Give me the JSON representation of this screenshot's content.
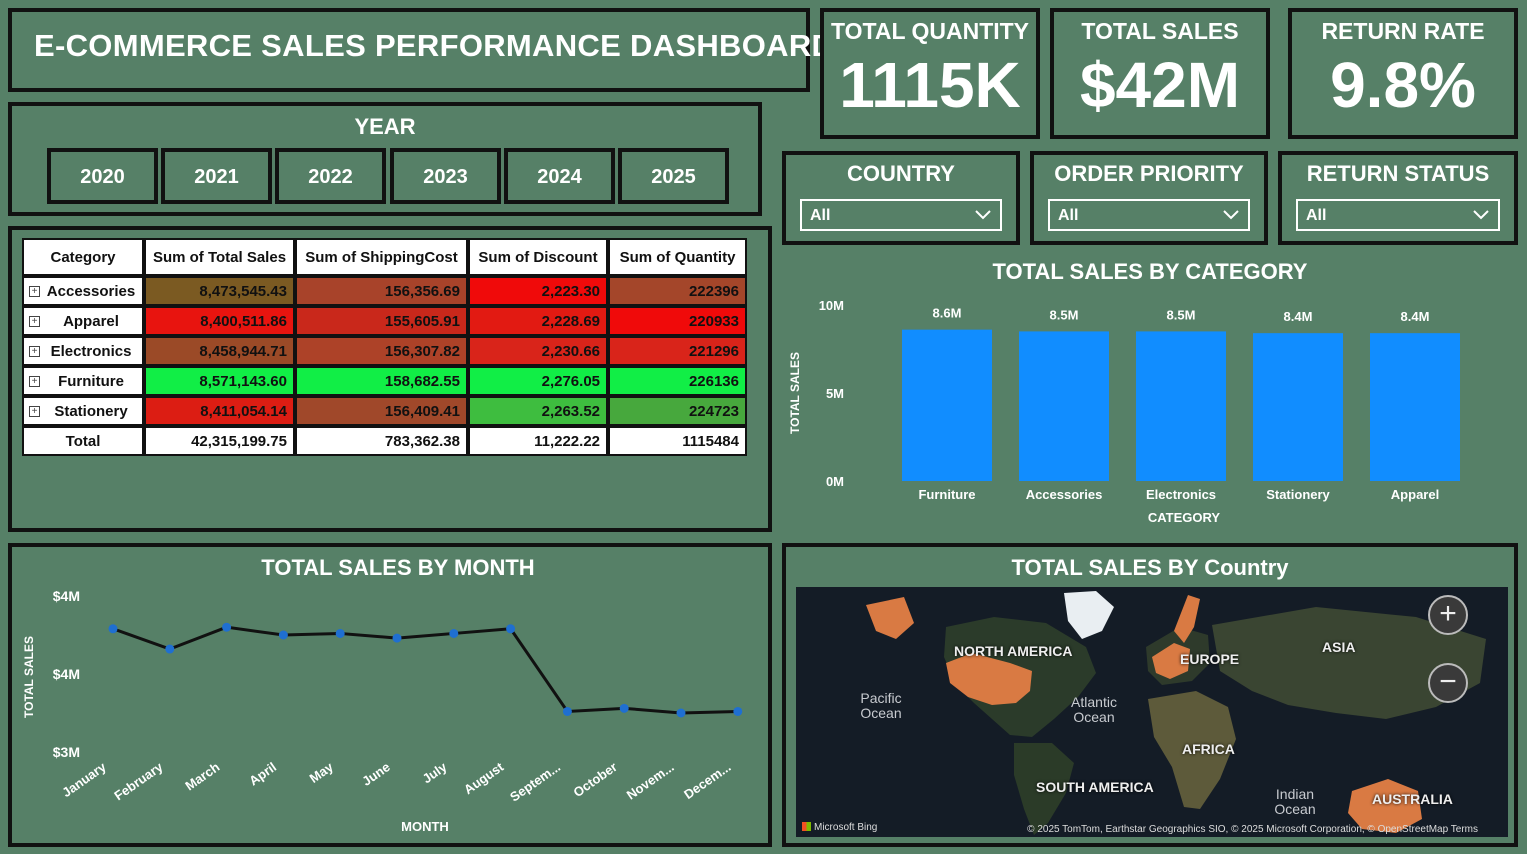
{
  "title": "E-COMMERCE SALES PERFORMANCE DASHBOARD",
  "kpis": {
    "quantity": {
      "label": "TOTAL QUANTITY",
      "value": "1115K"
    },
    "sales": {
      "label": "TOTAL SALES",
      "value": "$42M"
    },
    "return": {
      "label": "RETURN RATE",
      "value": "9.8%"
    }
  },
  "year_slicer": {
    "label": "YEAR",
    "years": [
      "2020",
      "2021",
      "2022",
      "2023",
      "2024",
      "2025"
    ]
  },
  "slicers": {
    "country": {
      "label": "COUNTRY",
      "value": "All"
    },
    "priority": {
      "label": "ORDER PRIORITY",
      "value": "All"
    },
    "return_status": {
      "label": "RETURN STATUS",
      "value": "All"
    }
  },
  "matrix": {
    "headers": [
      "Category",
      "Sum of Total Sales",
      "Sum of ShippingCost",
      "Sum of Discount",
      "Sum of Quantity"
    ],
    "rows": [
      {
        "category": "Accessories",
        "sales": "8,473,545.43",
        "shipping": "156,356.69",
        "discount": "2,223.30",
        "quantity": "222396",
        "colors": [
          "#7b5a22",
          "#a8432a",
          "#f00a0a",
          "#a4462a"
        ]
      },
      {
        "category": "Apparel",
        "sales": "8,400,511.86",
        "shipping": "155,605.91",
        "discount": "2,228.69",
        "quantity": "220933",
        "colors": [
          "#e8140f",
          "#c9281b",
          "#e21a12",
          "#f00a0a"
        ]
      },
      {
        "category": "Electronics",
        "sales": "8,458,944.71",
        "shipping": "156,307.82",
        "discount": "2,230.66",
        "quantity": "221296",
        "colors": [
          "#9b4a27",
          "#ad4228",
          "#d9241a",
          "#d9241a"
        ]
      },
      {
        "category": "Furniture",
        "sales": "8,571,143.60",
        "shipping": "158,682.55",
        "discount": "2,276.05",
        "quantity": "226136",
        "colors": [
          "#11ee46",
          "#11ee46",
          "#11ee46",
          "#11ee46"
        ]
      },
      {
        "category": "Stationery",
        "sales": "8,411,054.14",
        "shipping": "156,409.41",
        "discount": "2,263.52",
        "quantity": "224723",
        "colors": [
          "#dc1d13",
          "#a0482a",
          "#3ebd3f",
          "#47a83d"
        ]
      }
    ],
    "total": {
      "category": "Total",
      "sales": "42,315,199.75",
      "shipping": "783,362.38",
      "discount": "11,222.22",
      "quantity": "1115484"
    }
  },
  "chart_data": [
    {
      "type": "bar",
      "title": "TOTAL SALES BY CATEGORY",
      "xlabel": "CATEGORY",
      "ylabel": "TOTAL SALES",
      "categories": [
        "Furniture",
        "Accessories",
        "Electronics",
        "Stationery",
        "Apparel"
      ],
      "values": [
        8.6,
        8.5,
        8.5,
        8.4,
        8.4
      ],
      "data_labels": [
        "8.6M",
        "8.5M",
        "8.5M",
        "8.4M",
        "8.4M"
      ],
      "ylim": [
        0,
        10
      ],
      "yticks": [
        0,
        5,
        10
      ],
      "ytick_labels": [
        "0M",
        "5M",
        "10M"
      ],
      "bar_color": "#118dff"
    },
    {
      "type": "line",
      "title": "TOTAL SALES BY MONTH",
      "xlabel": "MONTH",
      "ylabel": "TOTAL SALES",
      "categories": [
        "January",
        "February",
        "March",
        "April",
        "May",
        "June",
        "July",
        "August",
        "Septem...",
        "October",
        "Novem...",
        "Decem..."
      ],
      "values": [
        3.79,
        3.66,
        3.8,
        3.75,
        3.76,
        3.73,
        3.76,
        3.79,
        3.26,
        3.28,
        3.25,
        3.26
      ],
      "ylim": [
        3.0,
        4.0
      ],
      "yticks": [
        3.0,
        3.5,
        4.0
      ],
      "ytick_labels": [
        "$3M",
        "$4M",
        "$4M"
      ],
      "line_color": "#111111",
      "marker_color": "#1f6fd1"
    }
  ],
  "map": {
    "title": "TOTAL SALES BY Country",
    "regions": [
      "NORTH AMERICA",
      "EUROPE",
      "ASIA",
      "AFRICA",
      "SOUTH AMERICA",
      "AUSTRALIA"
    ],
    "oceans": [
      "Pacific Ocean",
      "Atlantic Ocean",
      "Indian Ocean"
    ],
    "attribution": "© 2025 TomTom, Earthstar Geographics SIO, © 2025 Microsoft Corporation, © OpenStreetMap  Terms",
    "provider": "Microsoft Bing",
    "highlight_color": "#d97a43"
  }
}
